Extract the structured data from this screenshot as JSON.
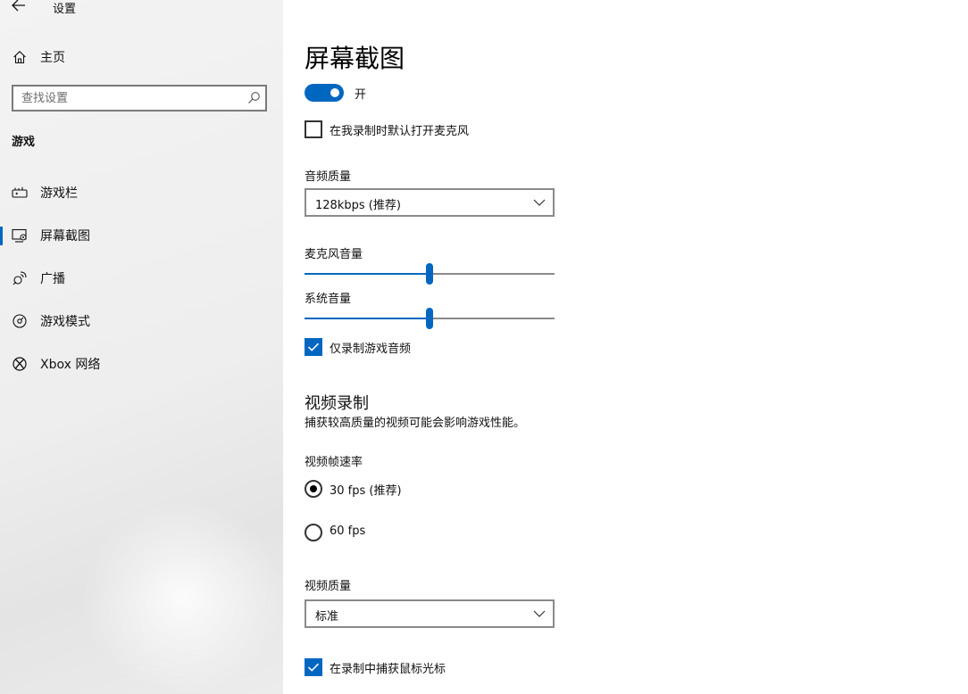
{
  "app": {
    "title": "设置",
    "home_label": "主页",
    "search_placeholder": "查找设置"
  },
  "sidebar": {
    "section_title": "游戏",
    "items": [
      {
        "label": "游戏栏",
        "icon": "game-bar-icon",
        "selected": false
      },
      {
        "label": "屏幕截图",
        "icon": "capture-icon",
        "selected": true
      },
      {
        "label": "广播",
        "icon": "broadcast-icon",
        "selected": false
      },
      {
        "label": "游戏模式",
        "icon": "game-mode-icon",
        "selected": false
      },
      {
        "label": "Xbox 网络",
        "icon": "xbox-icon",
        "selected": false
      }
    ]
  },
  "main": {
    "title": "屏幕截图",
    "toggle": {
      "label": "开",
      "on": true
    },
    "mic_default_checkbox": {
      "label": "在我录制时默认打开麦克风",
      "checked": false
    },
    "audio_quality": {
      "label": "音频质量",
      "value": "128kbps (推荐)"
    },
    "mic_volume": {
      "label": "麦克风音量",
      "level": 0.5
    },
    "system_volume": {
      "label": "系统音量",
      "level": 0.5
    },
    "game_audio_only_checkbox": {
      "label": "仅录制游戏音频",
      "checked": true
    },
    "video_section": {
      "heading": "视频录制",
      "description": "捕获较高质量的视频可能会影响游戏性能。"
    },
    "frame_rate": {
      "label": "视频帧速率",
      "options": [
        {
          "label": "30 fps (推荐)",
          "selected": true
        },
        {
          "label": "60 fps",
          "selected": false
        }
      ]
    },
    "video_quality": {
      "label": "视频质量",
      "value": "标准"
    },
    "capture_cursor_checkbox": {
      "label": "在录制中捕获鼠标光标",
      "checked": true
    }
  },
  "colors": {
    "accent": "#0067c0",
    "sidebar_bg": "#eeeeee"
  }
}
